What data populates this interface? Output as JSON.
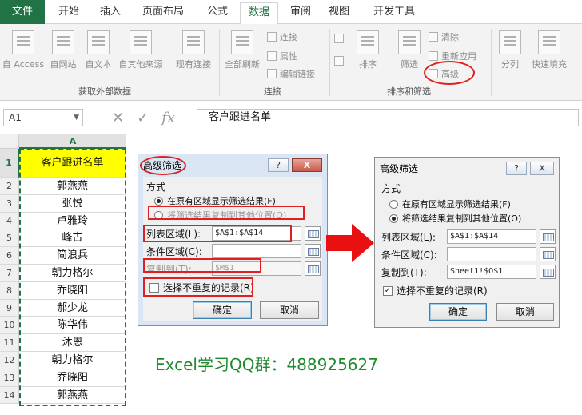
{
  "ribbon": {
    "tabs": [
      "文件",
      "开始",
      "插入",
      "页面布局",
      "公式",
      "数据",
      "审阅",
      "视图",
      "开发工具"
    ],
    "active_tab": "数据",
    "external_data": {
      "buttons": [
        "自 Access",
        "自网站",
        "自文本",
        "自其他来源",
        "现有连接"
      ],
      "label": "获取外部数据"
    },
    "connections": {
      "refresh_all": "全部刷新",
      "small": [
        "连接",
        "属性",
        "编辑链接"
      ],
      "label": "连接"
    },
    "sort_filter": {
      "sort": "排序",
      "filter": "筛选",
      "small": [
        "清除",
        "重新应用",
        "高级"
      ],
      "label": "排序和筛选"
    },
    "data_tools": {
      "buttons": [
        "分列",
        "快速填充"
      ]
    }
  },
  "formula_bar": {
    "name_box": "A1",
    "fx": "fx",
    "content": "客户跟进名单"
  },
  "sheet": {
    "column": "A",
    "rows": [
      "1",
      "2",
      "3",
      "4",
      "5",
      "6",
      "7",
      "8",
      "9",
      "10",
      "11",
      "12",
      "13",
      "14"
    ],
    "cells": [
      "客户跟进名单",
      "郭燕燕",
      "张悦",
      "卢雅玲",
      "峰古",
      "简浪兵",
      "朝力格尔",
      "乔晓阳",
      "郝少龙",
      "陈华伟",
      "沐恩",
      "朝力格尔",
      "乔晓阳",
      "郭燕燕"
    ]
  },
  "dialog_left": {
    "title": "高级筛选",
    "help": "?",
    "close": "X",
    "section": "方式",
    "radio_in_place": "在原有区域显示筛选结果(F)",
    "radio_copy": "将筛选结果复制到其他位置(O)",
    "list_range_label": "列表区域(L):",
    "list_range_value": "$A$1:$A$14",
    "criteria_label": "条件区域(C):",
    "criteria_value": "",
    "copy_to_label": "复制到(T):",
    "copy_to_value": "$M$1",
    "unique_label": "选择不重复的记录(R)",
    "ok": "确定",
    "cancel": "取消"
  },
  "dialog_right": {
    "title": "高级筛选",
    "help": "?",
    "close": "X",
    "section": "方式",
    "radio_in_place": "在原有区域显示筛选结果(F)",
    "radio_copy": "将筛选结果复制到其他位置(O)",
    "list_range_label": "列表区域(L):",
    "list_range_value": "$A$1:$A$14",
    "criteria_label": "条件区域(C):",
    "criteria_value": "",
    "copy_to_label": "复制到(T):",
    "copy_to_value": "Sheet1!$O$1",
    "unique_label": "选择不重复的记录(R)",
    "unique_checked": "✓",
    "ok": "确定",
    "cancel": "取消"
  },
  "caption": "Excel学习QQ群：488925627",
  "colors": {
    "excel_green": "#217346",
    "header_fill": "#ffff00",
    "annotation_red": "#e02020",
    "caption_green": "#1f8a2e"
  }
}
